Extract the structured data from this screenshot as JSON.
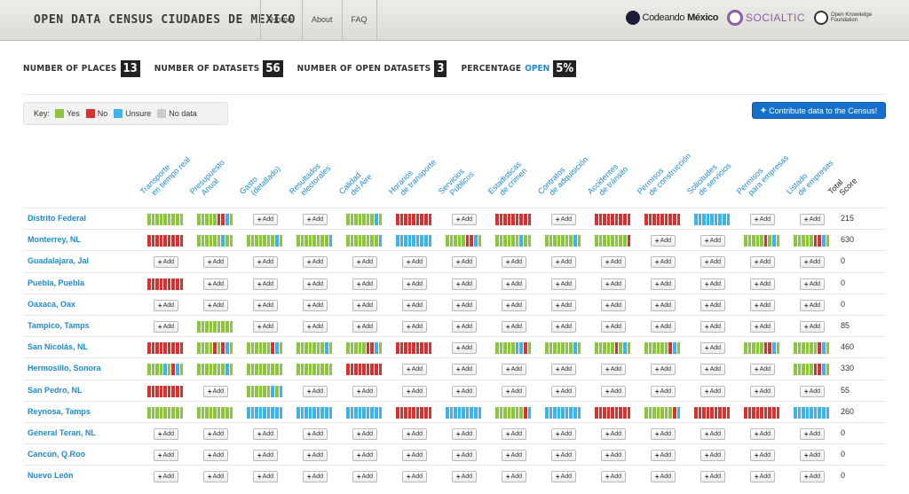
{
  "header": {
    "title": "OPEN DATA CENSUS CIUDADES DE MEXICO",
    "nav": [
      "Home",
      "About",
      "FAQ"
    ],
    "logos": {
      "codeando_a": "Codeando",
      "codeando_b": "México",
      "socialtic": "SOCIALTIC",
      "okfn": "Open Knowledge Foundation"
    }
  },
  "stats": {
    "places_label": "NUMBER OF PLACES",
    "places_value": "13",
    "datasets_label": "NUMBER OF DATASETS",
    "datasets_value": "56",
    "open_datasets_label": "NUMBER OF OPEN DATASETS",
    "open_datasets_value": "3",
    "percentage_label": "PERCENTAGE",
    "percentage_open": "OPEN",
    "percentage_value": "5%"
  },
  "key": {
    "label": "Key:",
    "items": [
      {
        "label": "Yes",
        "color": "#8cc63f"
      },
      {
        "label": "No",
        "color": "#d9312f"
      },
      {
        "label": "Unsure",
        "color": "#3ab4ea"
      },
      {
        "label": "No data",
        "color": "#cccccc"
      }
    ]
  },
  "contribute_label": "Contribute data to the Census!",
  "add_label": "Add",
  "columns": [
    [
      "Transporte",
      "en tiempo real"
    ],
    [
      "Presupuesto",
      "Anual"
    ],
    [
      "Gasto",
      "(detallado)"
    ],
    [
      "Resultados",
      "electorales"
    ],
    [
      "Calidad",
      "del Aire"
    ],
    [
      "Horarios",
      "de transporte"
    ],
    [
      "Servicios",
      "Públicos"
    ],
    [
      "Estadisticas",
      "de crimen"
    ],
    [
      "Contratos",
      "de adquisición"
    ],
    [
      "Accidentes",
      "de tránsito"
    ],
    [
      "Permisos",
      "de construcción"
    ],
    [
      "Solicitudes",
      "de servicios"
    ],
    [
      "Permisos",
      "para empresas"
    ],
    [
      "Listado",
      "de empresas"
    ]
  ],
  "total_label": [
    "Total",
    "Score"
  ],
  "colors": {
    "G": "#8cc63f",
    "R": "#d9312f",
    "B": "#3ab4ea"
  },
  "rows": [
    {
      "place": "Distrito Federal",
      "score": "215",
      "cells": [
        "GGGGGGGGG",
        "GGGGGRRBG",
        "add",
        "add",
        "GGGGGGGBG",
        "RRRRRRRRR",
        "add",
        "RRRRRRRRR",
        "add",
        "RRRRRRRRR",
        "RRRRRRRRR",
        "BBBBBBBBB",
        "add",
        "add"
      ]
    },
    {
      "place": "Monterrey, NL",
      "score": "630",
      "cells": [
        "RRRRRRRRR",
        "GGGGGGBGG",
        "GGGGGGGBG",
        "GGGGGGGGB",
        "GGGGGGGGB",
        "BBBBBBBBB",
        "GGGGGRRBG",
        "GGGGGGBGG",
        "GGGGGGGBG",
        "GGGGGGGGR",
        "add",
        "add",
        "GGGGGRGBG",
        "GGGGGRRBG"
      ]
    },
    {
      "place": "Guadalajara, Jal",
      "score": "0",
      "cells": [
        "add",
        "add",
        "add",
        "add",
        "add",
        "add",
        "add",
        "add",
        "add",
        "add",
        "add",
        "add",
        "add",
        "add"
      ]
    },
    {
      "place": "Puebla, Puebla",
      "score": "0",
      "cells": [
        "RRRRRRRRR",
        "add",
        "add",
        "add",
        "add",
        "add",
        "add",
        "add",
        "add",
        "add",
        "add",
        "add",
        "add",
        "add"
      ]
    },
    {
      "place": "Oaxaca, Oax",
      "score": "0",
      "cells": [
        "add",
        "add",
        "add",
        "add",
        "add",
        "add",
        "add",
        "add",
        "add",
        "add",
        "add",
        "add",
        "add",
        "add"
      ]
    },
    {
      "place": "Tampico, Tamps",
      "score": "85",
      "cells": [
        "add",
        "GGGGGGGGG",
        "add",
        "add",
        "add",
        "add",
        "add",
        "add",
        "add",
        "add",
        "add",
        "add",
        "add",
        "add"
      ]
    },
    {
      "place": "San Nicolás, NL",
      "score": "460",
      "cells": [
        "RRRRRRRRR",
        "GGGGRGRBG",
        "GGGGGGRBG",
        "GGGGGGGBG",
        "GGGGGRRBG",
        "RRRRRRRRR",
        "add",
        "GGGGGBBRG",
        "GGGGGGGBG",
        "GGGGGRGBG",
        "GGGGGGRBG",
        "add",
        "GGGGGRRBG",
        "GGGGGGRBG"
      ]
    },
    {
      "place": "Hermosillo, Sonora",
      "score": "330",
      "cells": [
        "GGGGBGRBG",
        "GGGGGGGBG",
        "GGGGGGGGG",
        "GGGGGGGGG",
        "RRRRRRRRR",
        "add",
        "add",
        "add",
        "add",
        "add",
        "add",
        "add",
        "add",
        "GGGGGRRBG"
      ]
    },
    {
      "place": "San Pedro, NL",
      "score": "55",
      "cells": [
        "RRRRRRRRR",
        "add",
        "GGGGGGBGB",
        "add",
        "add",
        "add",
        "add",
        "add",
        "add",
        "add",
        "add",
        "add",
        "add",
        "add"
      ]
    },
    {
      "place": "Reynosa, Tamps",
      "score": "260",
      "cells": [
        "GGGGGGGGG",
        "GGGGGGGGG",
        "BBBBBBBBB",
        "BBBBBBBBB",
        "BBBBBBBBB",
        "RRRRRRRRR",
        "BBBBBBBBB",
        "GGGGGGGRB",
        "BBBBBBBBB",
        "RRRRRRRRR",
        "GGGGGGGRB",
        "RRRRRRRRR",
        "RRRRRRRRR",
        "BBBBBBBBB"
      ]
    },
    {
      "place": "General Teran, NL",
      "score": "0",
      "cells": [
        "add",
        "add",
        "add",
        "add",
        "add",
        "add",
        "add",
        "add",
        "add",
        "add",
        "add",
        "add",
        "add",
        "add"
      ]
    },
    {
      "place": "Cancún, Q.Roo",
      "score": "0",
      "cells": [
        "add",
        "add",
        "add",
        "add",
        "add",
        "add",
        "add",
        "add",
        "add",
        "add",
        "add",
        "add",
        "add",
        "add"
      ]
    },
    {
      "place": "Nuevo León",
      "score": "0",
      "cells": [
        "add",
        "add",
        "add",
        "add",
        "add",
        "add",
        "add",
        "add",
        "add",
        "add",
        "add",
        "add",
        "add",
        "add"
      ]
    }
  ]
}
